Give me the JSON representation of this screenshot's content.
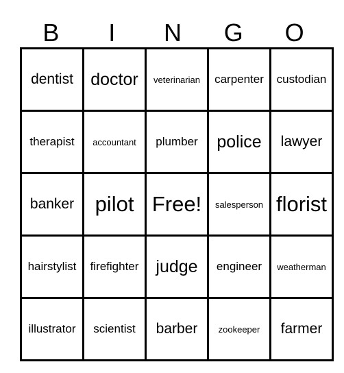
{
  "header": [
    "B",
    "I",
    "N",
    "G",
    "O"
  ],
  "rows": [
    [
      {
        "t": "dentist",
        "s": "l"
      },
      {
        "t": "doctor",
        "s": "xl"
      },
      {
        "t": "veterinarian",
        "s": "s"
      },
      {
        "t": "carpenter",
        "s": "m"
      },
      {
        "t": "custodian",
        "s": "m"
      }
    ],
    [
      {
        "t": "therapist",
        "s": "m"
      },
      {
        "t": "accountant",
        "s": "s"
      },
      {
        "t": "plumber",
        "s": "m"
      },
      {
        "t": "police",
        "s": "xl"
      },
      {
        "t": "lawyer",
        "s": "l"
      }
    ],
    [
      {
        "t": "banker",
        "s": "l"
      },
      {
        "t": "pilot",
        "s": "xxl"
      },
      {
        "t": "Free!",
        "s": "xxl"
      },
      {
        "t": "salesperson",
        "s": "s"
      },
      {
        "t": "florist",
        "s": "xxl"
      }
    ],
    [
      {
        "t": "hairstylist",
        "s": "m"
      },
      {
        "t": "firefighter",
        "s": "m"
      },
      {
        "t": "judge",
        "s": "xl"
      },
      {
        "t": "engineer",
        "s": "m"
      },
      {
        "t": "weatherman",
        "s": "s"
      }
    ],
    [
      {
        "t": "illustrator",
        "s": "m"
      },
      {
        "t": "scientist",
        "s": "m"
      },
      {
        "t": "barber",
        "s": "l"
      },
      {
        "t": "zookeeper",
        "s": "s"
      },
      {
        "t": "farmer",
        "s": "l"
      }
    ]
  ]
}
